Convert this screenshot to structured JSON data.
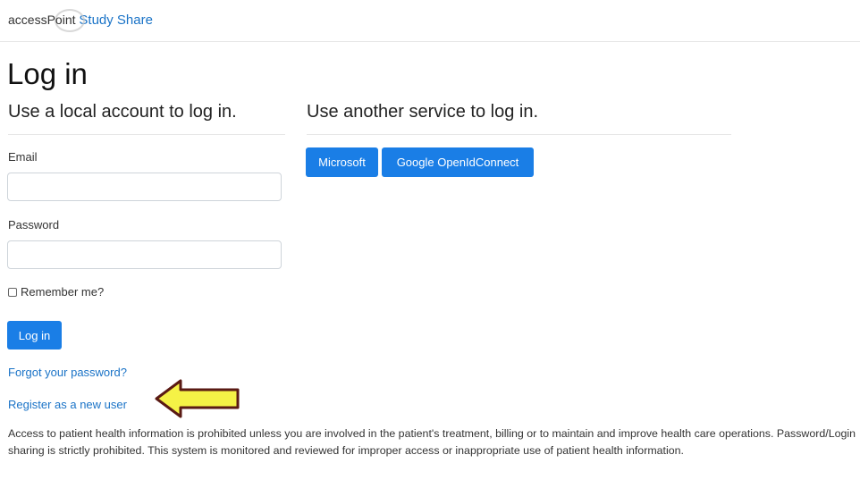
{
  "brand": {
    "access": "access",
    "point": "Point",
    "study_share": "Study Share"
  },
  "page_title": "Log in",
  "local": {
    "heading": "Use a local account to log in.",
    "email_label": "Email",
    "email_value": "",
    "password_label": "Password",
    "password_value": "",
    "remember_label": "Remember me?",
    "login_button": "Log in",
    "forgot_link": "Forgot your password?",
    "register_link": "Register as a new user"
  },
  "external": {
    "heading": "Use another service to log in.",
    "providers": [
      "Microsoft",
      "Google OpenIdConnect"
    ]
  },
  "notice": "Access to patient health information is prohibited unless you are involved in the patient's treatment, billing or to maintain and improve health care operations. Password/Login sharing is strictly prohibited. This system is monitored and reviewed for improper access or inappropriate use of patient health information.",
  "colors": {
    "primary": "#1a7ee6",
    "link": "#1a73c7",
    "arrow_fill": "#f5f246",
    "arrow_stroke": "#5a1a14"
  },
  "icons": {
    "register_pointer": "yellow-arrow-icon"
  }
}
